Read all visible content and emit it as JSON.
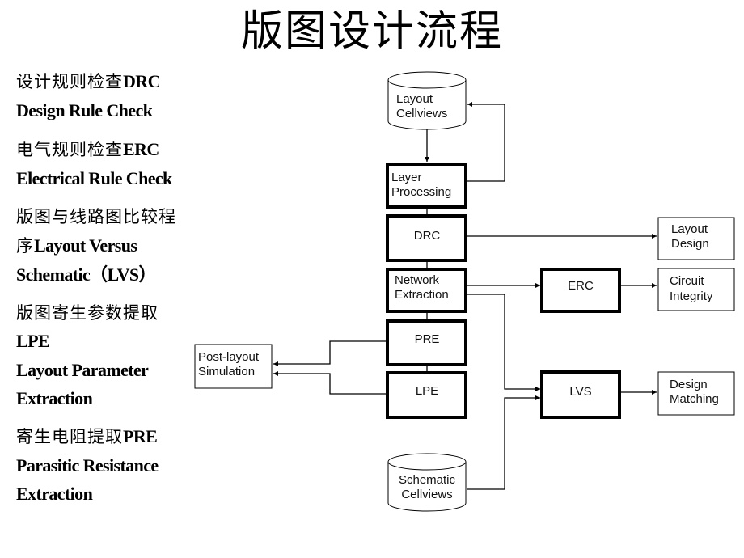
{
  "title": "版图设计流程",
  "notes": [
    {
      "cn": "设计规则检查",
      "en": "DRC"
    },
    {
      "en": "Design Rule Check"
    },
    {
      "cn": "电气规则检查",
      "en": "ERC"
    },
    {
      "en": "Electrical Rule Check"
    },
    {
      "cn": "版图与线路图比较程"
    },
    {
      "cn": "序",
      "en": "Layout Versus"
    },
    {
      "en": "Schematic（LVS）"
    },
    {
      "cn": "版图寄生参数提取"
    },
    {
      "en": "LPE"
    },
    {
      "en": "Layout Parameter"
    },
    {
      "en": "Extraction"
    },
    {
      "cn": "寄生电阻提取",
      "en": "PRE"
    },
    {
      "en": "Parasitic Resistance"
    },
    {
      "en": "Extraction"
    }
  ],
  "diagram": {
    "layout_cellviews": [
      "Layout",
      "Cellviews"
    ],
    "layer_processing": [
      "Layer",
      "Processing"
    ],
    "drc": "DRC",
    "network_extraction": [
      "Network",
      "Extraction"
    ],
    "pre": "PRE",
    "lpe": "LPE",
    "erc": "ERC",
    "lvs": "LVS",
    "layout_design": [
      "Layout",
      "Design"
    ],
    "circuit_integrity": [
      "Circuit",
      "Integrity"
    ],
    "design_matching": [
      "Design",
      "Matching"
    ],
    "post_layout_simulation": [
      "Post-layout",
      "Simulation"
    ],
    "schematic_cellviews": [
      "Schematic",
      "Cellviews"
    ]
  }
}
